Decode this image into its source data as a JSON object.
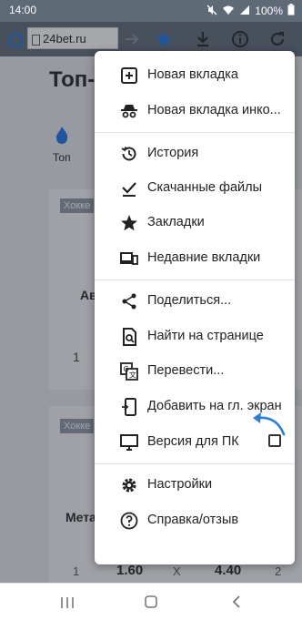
{
  "status": {
    "time": "14:00",
    "battery": "100%"
  },
  "browser": {
    "url": "24bet.ru"
  },
  "page": {
    "title": "Топ-",
    "tab_label": "Топ",
    "tag_1": "Хокке",
    "tag_2": "Хокке",
    "team_1": "Ав",
    "team_2": "Мета",
    "odds_row": [
      "1",
      "1.60",
      "X",
      "4.40",
      "2"
    ],
    "first_row_value": "1"
  },
  "menu": {
    "items": [
      {
        "label": "Новая вкладка",
        "icon": "new-tab-icon"
      },
      {
        "label": "Новая вкладка инко...",
        "icon": "incognito-icon"
      },
      {
        "label": "История",
        "icon": "history-icon"
      },
      {
        "label": "Скачанные файлы",
        "icon": "downloads-icon"
      },
      {
        "label": "Закладки",
        "icon": "star-icon"
      },
      {
        "label": "Недавние вкладки",
        "icon": "devices-icon"
      },
      {
        "label": "Поделиться...",
        "icon": "share-icon"
      },
      {
        "label": "Найти на странице",
        "icon": "find-icon"
      },
      {
        "label": "Перевести...",
        "icon": "translate-icon"
      },
      {
        "label": "Добавить на гл. экран",
        "icon": "add-to-home-icon"
      },
      {
        "label": "Версия для ПК",
        "icon": "desktop-icon"
      },
      {
        "label": "Настройки",
        "icon": "gear-icon"
      },
      {
        "label": "Справка/отзыв",
        "icon": "help-icon"
      }
    ],
    "desktop_checked": false
  },
  "colors": {
    "toolbar": "#5f6a77",
    "accent": "#1a73e8",
    "arrow": "#2d7fd3"
  }
}
